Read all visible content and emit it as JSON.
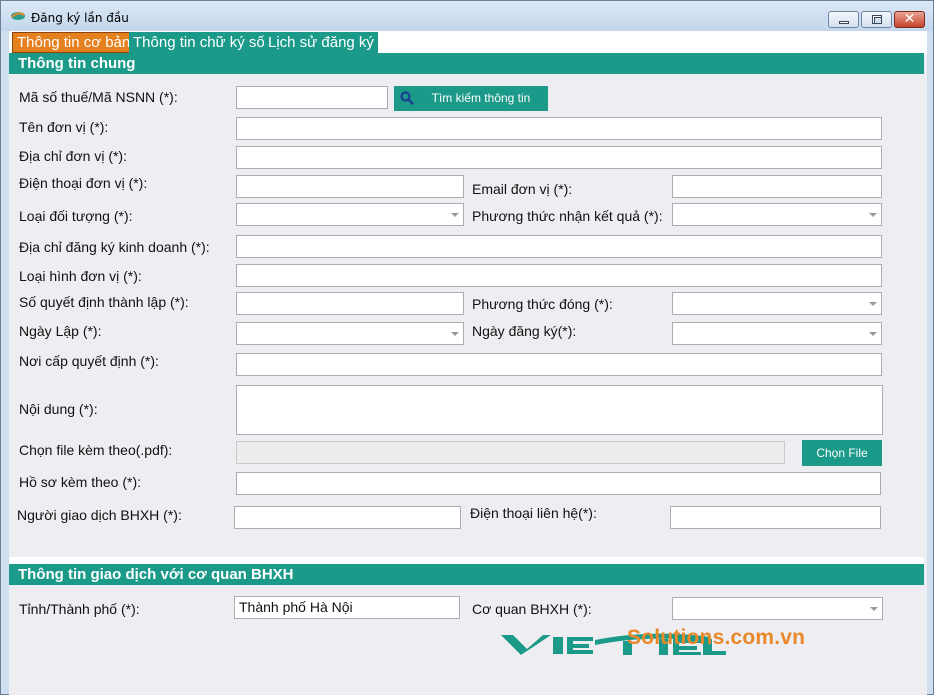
{
  "window": {
    "title": "Đăng ký lần đầu",
    "minimize_icon": "minimize-icon",
    "maximize_icon": "maximize-icon",
    "close_glyph": "✕"
  },
  "tabs": [
    {
      "label": "Thông tin cơ bản",
      "active": true
    },
    {
      "label": "Thông tin chữ ký số",
      "active": false
    },
    {
      "label": "Lịch sử đăng ký",
      "active": false
    }
  ],
  "general": {
    "header": "Thông tin chung",
    "tax_code_label": "Mã số thuế/Mã NSNN (*):",
    "tax_code_value": "",
    "search_button": "Tìm kiếm thông tin",
    "unit_name_label": "Tên đơn vị (*):",
    "unit_address_label": "Địa chỉ đơn vị (*):",
    "unit_phone_label": "Điện thoại đơn vị (*):",
    "email_label": "Email đơn vị (*):",
    "object_type_label": "Loại đối tượng (*):",
    "result_method_label": "Phương thức nhận kết quả (*):",
    "business_address_label": "Địa chỉ đăng ký kinh doanh (*):",
    "unit_type_label": "Loại hình đơn vị (*):",
    "decision_no_label": "Số quyết định thành lập (*):",
    "payment_method_label": "Phương thức đóng (*):",
    "date_created_label": "Ngày Lập (*):",
    "register_date_label": "Ngày đăng ký(*):",
    "issued_place_label": "Nơi cấp quyết định (*):",
    "content_label": "Nội dung (*):",
    "attach_file_label": "Chọn file kèm theo(.pdf):",
    "choose_file_button": "Chọn File",
    "attached_docs_label": "Hồ sơ kèm theo (*):",
    "bhxh_person_label": "Người giao dịch BHXH (*):",
    "contact_phone_label": "Điện thoại liên hệ(*):"
  },
  "transaction": {
    "header": "Thông tin giao dịch với cơ quan BHXH",
    "province_label": "Tỉnh/Thành phố (*):",
    "province_value": "Thành phố Hà Nội",
    "agency_label": "Cơ quan BHXH (*):",
    "agency_value": ""
  },
  "logo": {
    "brand": "VIETTEL",
    "sub": "Solutions.com.vn",
    "colors": {
      "teal": "#1b9a8a",
      "orange": "#e8882a"
    }
  },
  "colors": {
    "accent_teal": "#1b9a8a",
    "active_tab": "#e5801e"
  }
}
